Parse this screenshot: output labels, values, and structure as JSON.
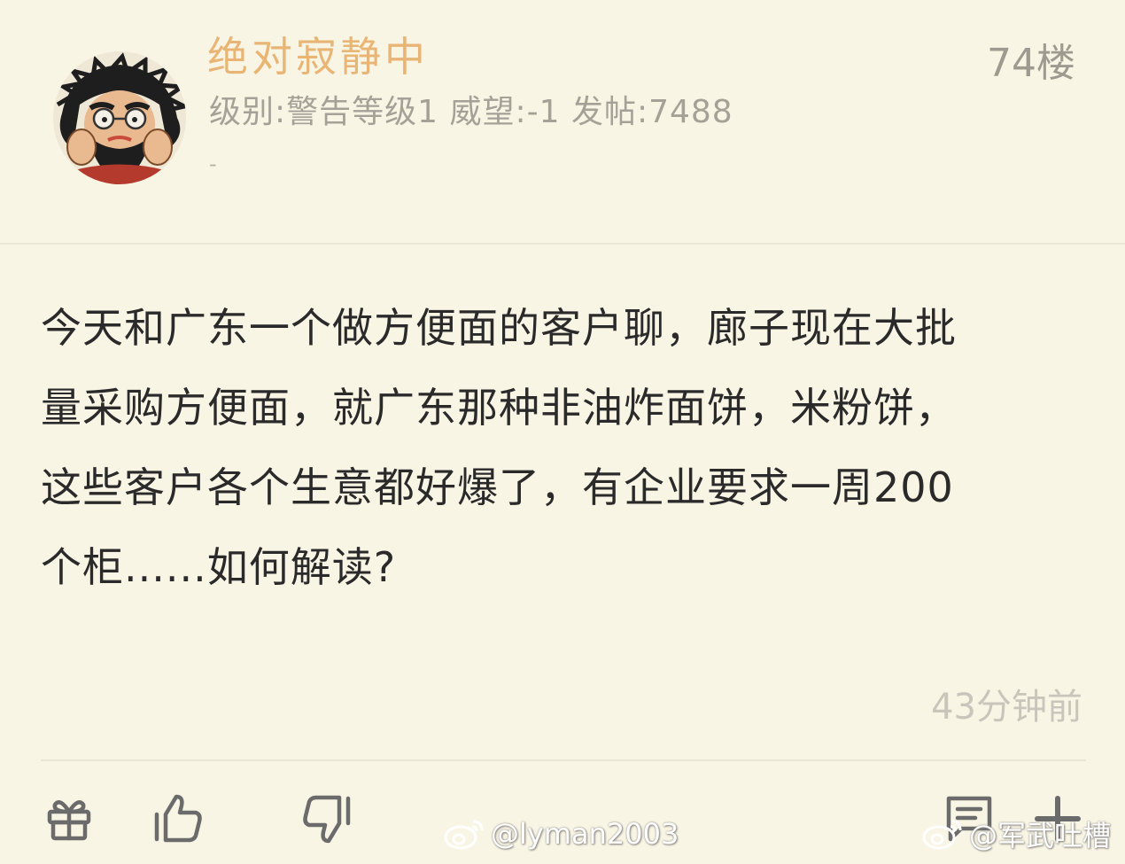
{
  "header": {
    "username": "绝对寂静中",
    "user_meta": "级别:警告等级1 威望:-1 发帖:7488",
    "user_extra": "-",
    "floor": "74楼"
  },
  "post": {
    "lines": [
      "今天和广东一个做方便面的客户聊，廊子现在大批",
      "量采购方便面，就广东那种非油炸面饼，米粉饼，",
      "这些客户各个生意都好爆了，有企业要求一周200",
      "个柜......如何解读?"
    ],
    "timestamp": "43分钟前"
  },
  "actions": {
    "gift": "gift-icon",
    "like": "thumbs-up-icon",
    "dislike": "thumbs-down-icon",
    "reply": "comment-icon",
    "add": "plus-icon"
  },
  "watermarks": [
    "@lyman2003",
    "@军武吐槽"
  ],
  "colors": {
    "background": "#f9f5e5",
    "username": "#e9b575",
    "meta": "#a5a197",
    "body_text": "#2a2a2a",
    "timestamp": "#c9c5bb",
    "icon": "#6b6b6b"
  }
}
